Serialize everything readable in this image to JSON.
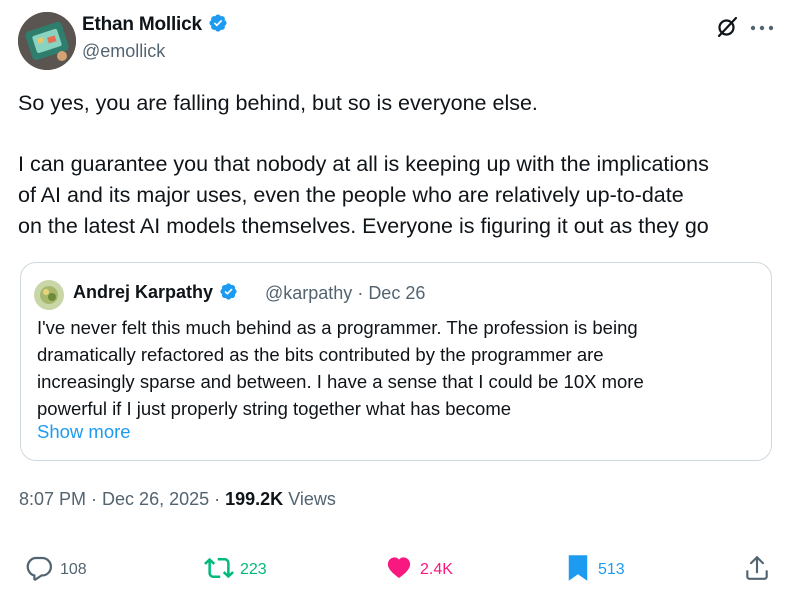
{
  "author": {
    "name": "Ethan Mollick",
    "handle": "@emollick",
    "verified": true
  },
  "tweet": {
    "lines": [
      "So yes, you are falling behind, but so is everyone else.",
      "I can guarantee you that nobody at all is keeping up with the implications",
      "of AI and its major uses, even the people who are relatively up-to-date",
      "on the latest AI models themselves. Everyone is figuring it out as they go"
    ]
  },
  "quote": {
    "name": "Andrej Karpathy",
    "handle": "@karpathy",
    "date": "Dec 26",
    "lines": [
      "I've never felt this much behind as a programmer. The profession is being",
      "dramatically refactored as the bits contributed by the programmer are",
      "increasingly sparse and between. I have a sense that I could be 10X more",
      "powerful if I just properly string together what has become"
    ],
    "show_more": "Show more"
  },
  "meta": {
    "time": "8:07 PM",
    "date": "Dec 26, 2025",
    "views_count": "199.2K",
    "views_label": "Views"
  },
  "actions": {
    "replies": "108",
    "reposts": "223",
    "likes": "2.4K",
    "bookmarks": "513"
  },
  "colors": {
    "text": "#0f1419",
    "secondary": "#536471",
    "link": "#1d9bf0",
    "verified": "#1d9bf0",
    "repost": "#00ba7c",
    "like": "#f91880",
    "bookmark": "#1d9bf0"
  },
  "icons": [
    "verified-badge-icon",
    "grok-icon",
    "more-icon",
    "reply-icon",
    "repost-icon",
    "like-icon",
    "bookmark-icon",
    "share-icon"
  ]
}
